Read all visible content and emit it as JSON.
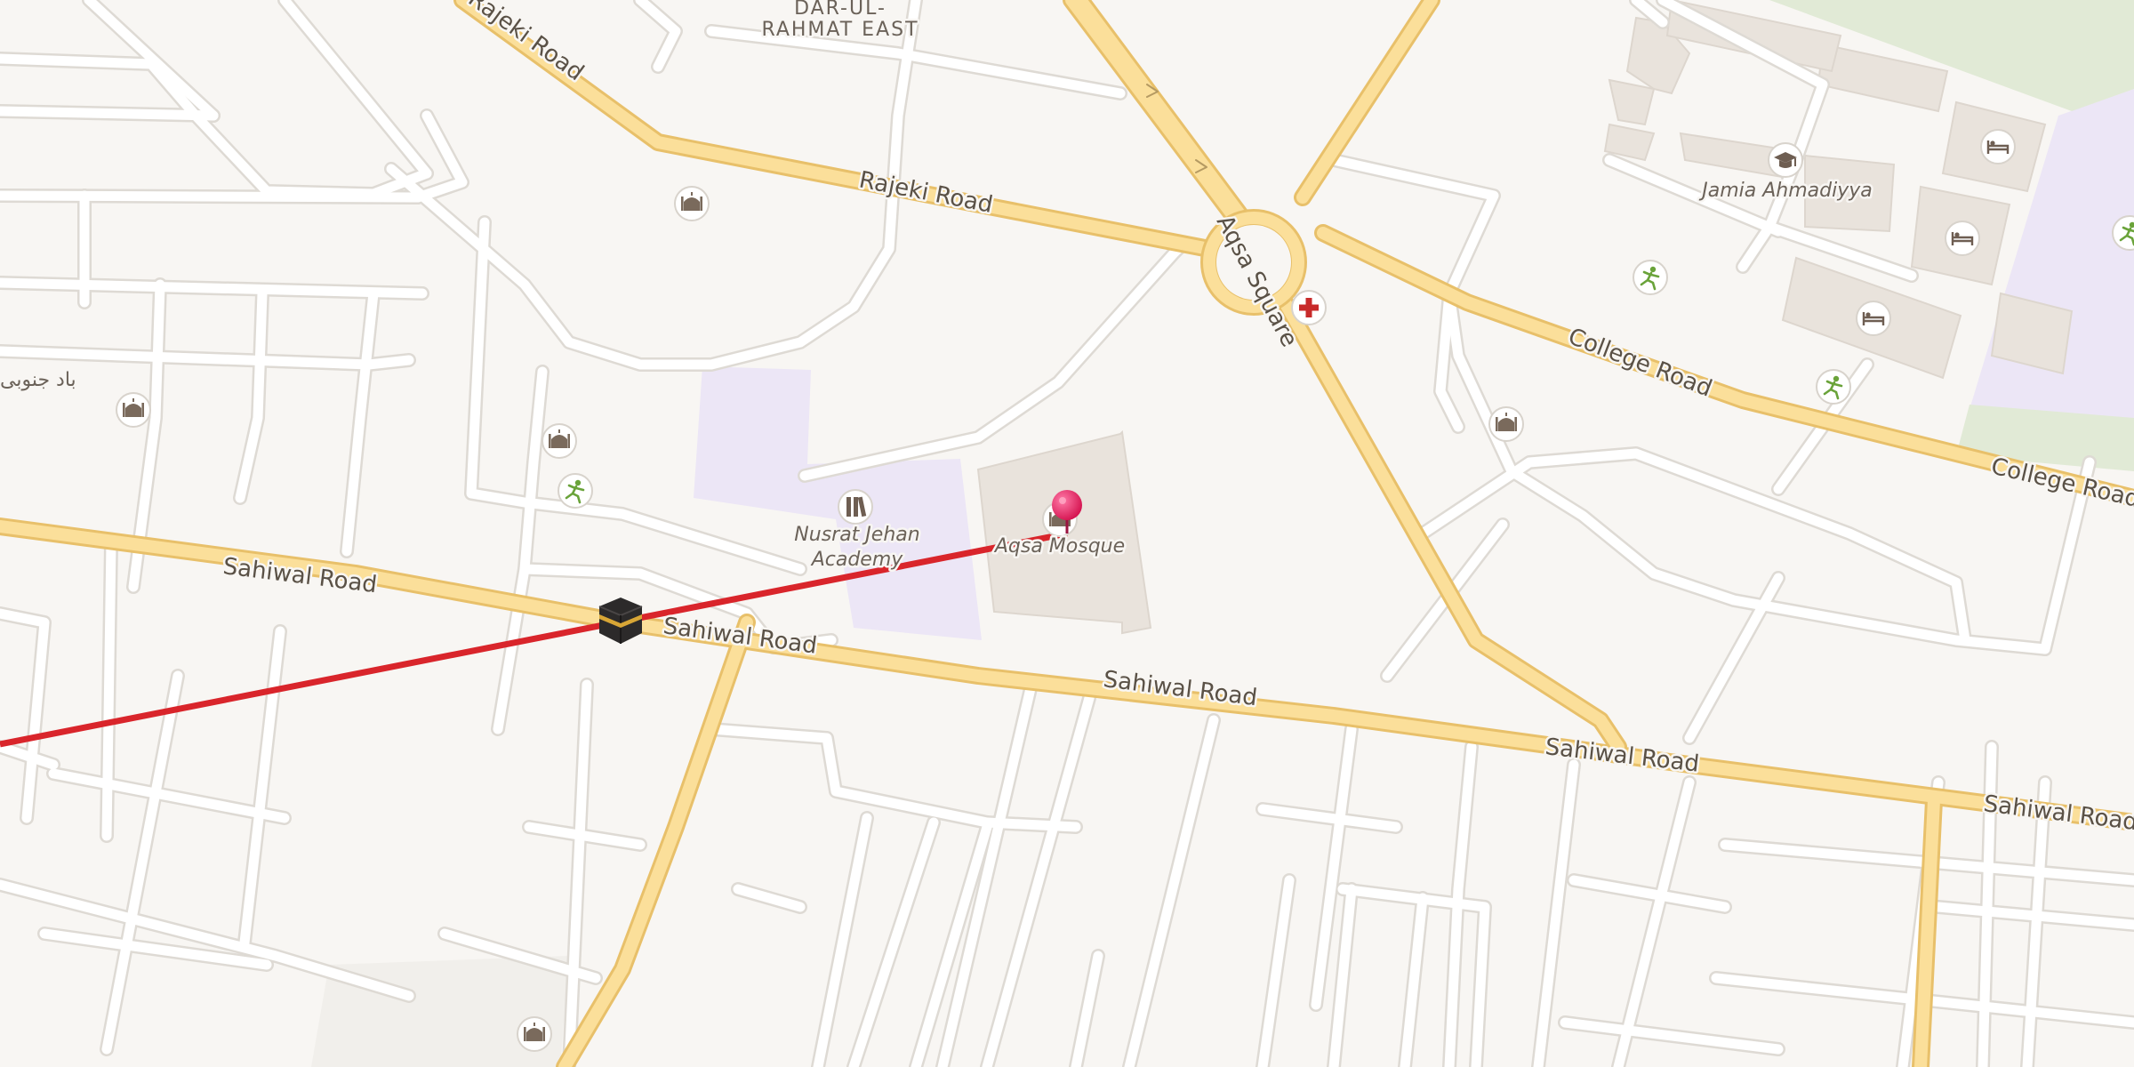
{
  "map": {
    "roads": {
      "sahiwal": "Sahiwal Road",
      "rajeki": "Rajeki Road",
      "college": "College Road",
      "aqsa_square": "Aqsa Square"
    },
    "places": {
      "dar_ul_rahmat_line1": "DAR-UL-",
      "dar_ul_rahmat_line2": "RAHMAT EAST",
      "urdu_area": "باد جنوبی"
    },
    "pois": {
      "nusrat_line1": "Nusrat Jehan",
      "nusrat_line2": "Academy",
      "aqsa_mosque": "Aqsa Mosque",
      "jamia": "Jamia Ahmadiyya"
    },
    "colors": {
      "background": "#f8f6f3",
      "major_road": "#fbdf9a",
      "major_road_casing": "#e8c06a",
      "minor_road": "#ffffff",
      "minor_road_casing": "#dedad4",
      "building": "#e9e3dc",
      "school_area": "#ece6f6",
      "park": "#e1ead6",
      "qibla_line": "#d9252b",
      "pin": "#e5185d"
    },
    "icons": [
      "mosque-icon",
      "sports-icon",
      "school-icon",
      "hospital-icon",
      "hotel-icon",
      "graduation-icon",
      "kaaba-icon",
      "location-pin-icon"
    ]
  }
}
